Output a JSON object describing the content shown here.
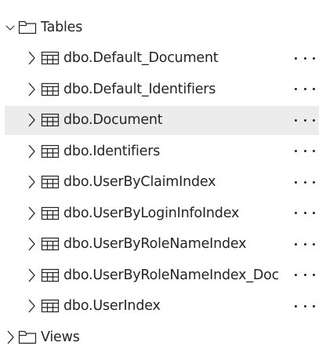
{
  "tree": {
    "tables_folder": {
      "label": "Tables",
      "expanded": true,
      "icon": "folder-icon",
      "chevron": "chevron-down-icon"
    },
    "tables": [
      {
        "label": "dbo.Default_Document",
        "icon": "table-icon",
        "selected": false
      },
      {
        "label": "dbo.Default_Identifiers",
        "icon": "table-icon",
        "selected": false
      },
      {
        "label": "dbo.Document",
        "icon": "table-icon",
        "selected": true
      },
      {
        "label": "dbo.Identifiers",
        "icon": "table-icon",
        "selected": false
      },
      {
        "label": "dbo.UserByClaimIndex",
        "icon": "table-icon",
        "selected": false
      },
      {
        "label": "dbo.UserByLoginInfoIndex",
        "icon": "table-icon",
        "selected": false
      },
      {
        "label": "dbo.UserByRoleNameIndex",
        "icon": "table-icon",
        "selected": false
      },
      {
        "label": "dbo.UserByRoleNameIndex_Doc",
        "icon": "table-icon",
        "selected": false
      },
      {
        "label": "dbo.UserIndex",
        "icon": "table-icon",
        "selected": false
      }
    ],
    "views_folder": {
      "label": "Views",
      "expanded": false,
      "icon": "folder-icon",
      "chevron": "chevron-right-icon"
    }
  },
  "colors": {
    "text": "#242424",
    "selected_background": "#ececec",
    "icon_stroke": "#242424"
  }
}
